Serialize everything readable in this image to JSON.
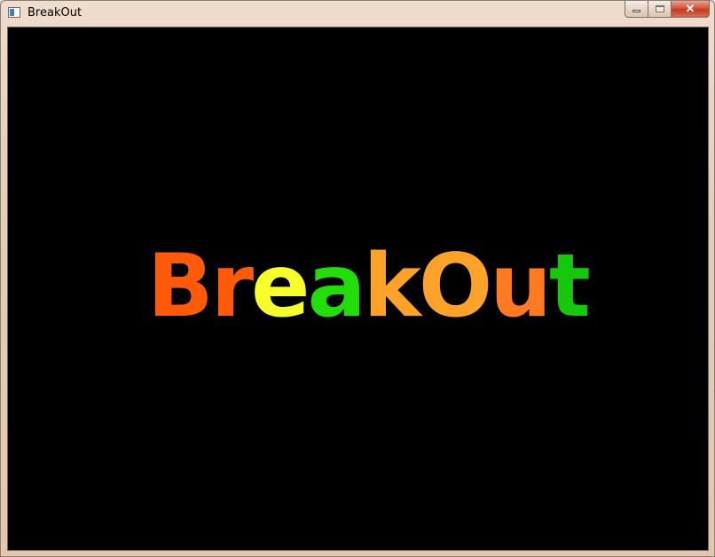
{
  "window": {
    "title": "BreakOut",
    "controls": {
      "minimize_icon": "minimize-icon",
      "maximize_icon": "maximize-icon",
      "close_icon": "close-icon",
      "close_label": "✕"
    }
  },
  "game": {
    "background": "#000000",
    "logo": {
      "letters": [
        {
          "char": "B",
          "color": "#ff5a0a"
        },
        {
          "char": "r",
          "color": "#ff5a0a"
        },
        {
          "char": "e",
          "color": "#f6ff2a"
        },
        {
          "char": "a",
          "color": "#22dd0a"
        },
        {
          "char": "k",
          "color": "#ffa22a"
        },
        {
          "char": "O",
          "color": "#ffa22a"
        },
        {
          "char": "u",
          "color": "#ff7a22"
        },
        {
          "char": "t",
          "color": "#16c80a"
        }
      ]
    }
  }
}
